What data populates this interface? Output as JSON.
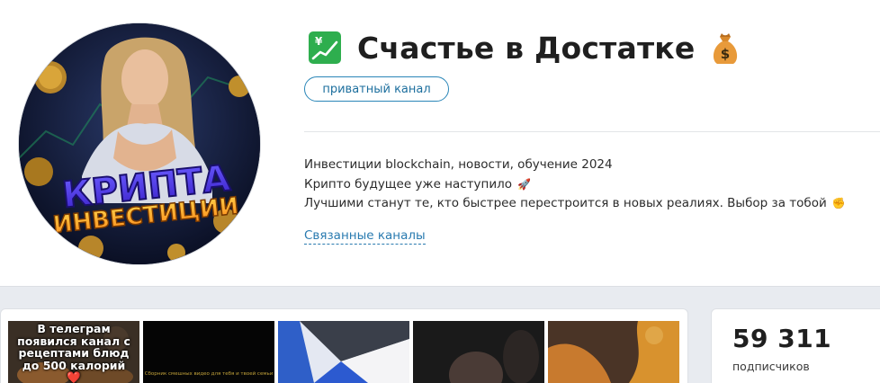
{
  "channel": {
    "title": "Счастье в Достатке",
    "title_emoji_left": "chart-with-yen-icon",
    "title_emoji_right": "money-bag-icon",
    "privacy_badge": "приватный канал",
    "avatar_text_line1": "КРИПТА",
    "avatar_text_line2": "ИНВЕСТИЦИИ",
    "description": [
      {
        "text": "Инвестиции blockchain, новости, обучение 2024",
        "emoji": ""
      },
      {
        "text": "Крипто будущее уже наступило",
        "emoji": "🚀"
      },
      {
        "text": "Лучшими станут те, кто быстрее перестроится в новых реалиях. Выбор за тобой",
        "emoji": "✊"
      }
    ],
    "related_link": "Связанные каналы"
  },
  "media": {
    "thumb1_text": "В телеграм появился канал с рецептами блюд до 500 калорий ❤️",
    "thumb2_text": "Сборник смешных видео для тебя и твоей семьи"
  },
  "stats": {
    "subscribers_count": "59 311",
    "subscribers_label": "подписчиков"
  },
  "colors": {
    "accent_link": "#2a7bb0",
    "badge_border": "#2a86b8",
    "lower_bg": "#e8ebf0",
    "emoji_green": "#2eae4e"
  }
}
